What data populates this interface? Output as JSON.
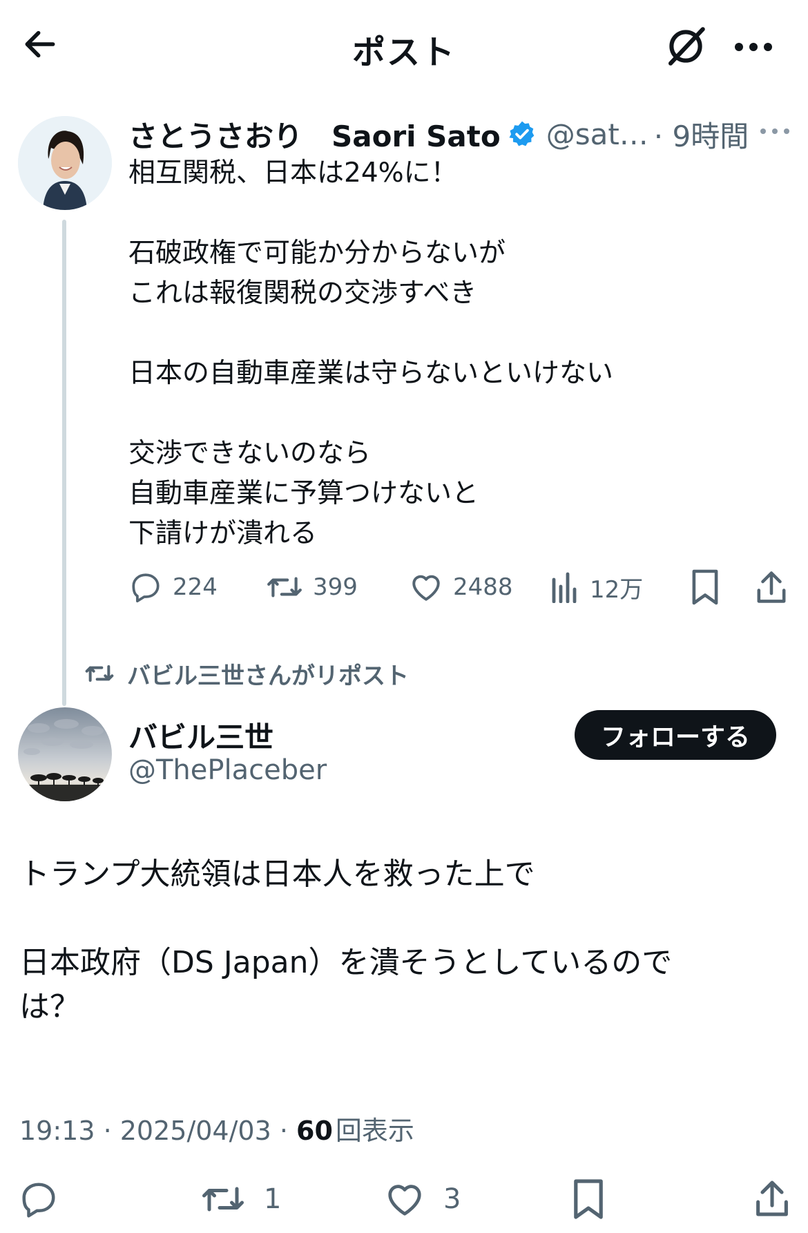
{
  "header": {
    "title": "ポスト",
    "back_icon": "arrow-left-icon",
    "grok_icon": "slash-circle-icon",
    "more_icon": "more-horizontal-icon"
  },
  "parent_post": {
    "display_name": "さとうさおり　Saori Sato",
    "handle": "@sat…",
    "time": "· 9時間",
    "verified": true,
    "text": "相互関税、日本は24%に！\n\n石破政権で可能か分からないが\nこれは報復関税の交渉すべき\n\n日本の自動車産業は守らないといけない\n\n交渉できないのなら\n自動車産業に予算つけないと\n下請けが潰れる",
    "actions": {
      "replies": "224",
      "reposts": "399",
      "likes": "2488",
      "views": "12万"
    }
  },
  "repost_banner": "バビル三世さんがリポスト",
  "main_post": {
    "display_name": "バビル三世",
    "handle": "@ThePlaceber",
    "follow_label": "フォローする",
    "text": "トランプ大統領は日本人を救った上で\n\n日本政府（DS Japan）を潰そうとしているので\nは？",
    "timestamp": "19:13 · 2025/04/03 · ",
    "views_count": "60",
    "views_label": "回表示",
    "actions": {
      "reposts": "1",
      "likes": "3"
    }
  },
  "colors": {
    "text": "#0f1419",
    "secondary": "#536471",
    "verified": "#1d9bf0",
    "line": "#cfd9de"
  }
}
